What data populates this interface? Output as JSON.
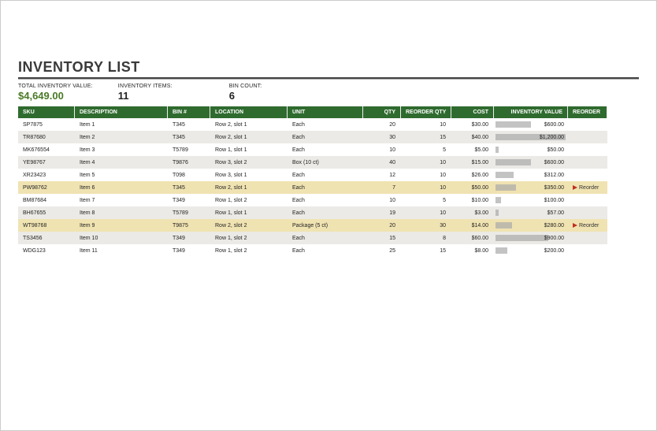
{
  "title": "INVENTORY LIST",
  "summary": {
    "total_label": "TOTAL INVENTORY VALUE:",
    "total_value": "$4,649.00",
    "items_label": "INVENTORY ITEMS:",
    "items_value": "11",
    "bins_label": "BIN COUNT:",
    "bins_value": "6"
  },
  "headers": {
    "sku": "SKU",
    "desc": "DESCRIPTION",
    "bin": "BIN #",
    "location": "LOCATION",
    "unit": "UNIT",
    "qty": "QTY",
    "reorder_qty": "REORDER QTY",
    "cost": "COST",
    "inv_value": "INVENTORY VALUE",
    "reorder": "REORDER"
  },
  "max_value": 1200,
  "rows": [
    {
      "sku": "SP7875",
      "desc": "Item 1",
      "bin": "T345",
      "loc": "Row 2, slot 1",
      "unit": "Each",
      "qty": "20",
      "rqty": "10",
      "cost": "$30.00",
      "val_num": 600,
      "val": "$600.00",
      "warn": false
    },
    {
      "sku": "TR87680",
      "desc": "Item 2",
      "bin": "T345",
      "loc": "Row 2, slot 1",
      "unit": "Each",
      "qty": "30",
      "rqty": "15",
      "cost": "$40.00",
      "val_num": 1200,
      "val": "$1,200.00",
      "warn": false
    },
    {
      "sku": "MK676554",
      "desc": "Item 3",
      "bin": "T5789",
      "loc": "Row 1, slot 1",
      "unit": "Each",
      "qty": "10",
      "rqty": "5",
      "cost": "$5.00",
      "val_num": 50,
      "val": "$50.00",
      "warn": false
    },
    {
      "sku": "YE98767",
      "desc": "Item 4",
      "bin": "T9876",
      "loc": "Row 3, slot 2",
      "unit": "Box (10 ct)",
      "qty": "40",
      "rqty": "10",
      "cost": "$15.00",
      "val_num": 600,
      "val": "$600.00",
      "warn": false
    },
    {
      "sku": "XR23423",
      "desc": "Item 5",
      "bin": "T098",
      "loc": "Row 3, slot 1",
      "unit": "Each",
      "qty": "12",
      "rqty": "10",
      "cost": "$26.00",
      "val_num": 312,
      "val": "$312.00",
      "warn": false
    },
    {
      "sku": "PW98762",
      "desc": "Item 6",
      "bin": "T345",
      "loc": "Row 2, slot 1",
      "unit": "Each",
      "qty": "7",
      "rqty": "10",
      "cost": "$50.00",
      "val_num": 350,
      "val": "$350.00",
      "warn": true,
      "reorder": "Reorder"
    },
    {
      "sku": "BM87684",
      "desc": "Item 7",
      "bin": "T349",
      "loc": "Row 1, slot 2",
      "unit": "Each",
      "qty": "10",
      "rqty": "5",
      "cost": "$10.00",
      "val_num": 100,
      "val": "$100.00",
      "warn": false
    },
    {
      "sku": "BH67655",
      "desc": "Item 8",
      "bin": "T5789",
      "loc": "Row 1, slot 1",
      "unit": "Each",
      "qty": "19",
      "rqty": "10",
      "cost": "$3.00",
      "val_num": 57,
      "val": "$57.00",
      "warn": false
    },
    {
      "sku": "WT98768",
      "desc": "Item 9",
      "bin": "T9875",
      "loc": "Row 2, slot 2",
      "unit": "Package (5 ct)",
      "qty": "20",
      "rqty": "30",
      "cost": "$14.00",
      "val_num": 280,
      "val": "$280.00",
      "warn": true,
      "reorder": "Reorder"
    },
    {
      "sku": "TS3456",
      "desc": "Item 10",
      "bin": "T349",
      "loc": "Row 1, slot 2",
      "unit": "Each",
      "qty": "15",
      "rqty": "8",
      "cost": "$60.00",
      "val_num": 900,
      "val": "$900.00",
      "warn": false
    },
    {
      "sku": "WDG123",
      "desc": "Item 11",
      "bin": "T349",
      "loc": "Row 1, slot 2",
      "unit": "Each",
      "qty": "25",
      "rqty": "15",
      "cost": "$8.00",
      "val_num": 200,
      "val": "$200.00",
      "warn": false
    }
  ],
  "chart_data": {
    "type": "bar",
    "title": "Inventory Value by SKU (in-cell data bars)",
    "xlabel": "SKU",
    "ylabel": "Inventory Value ($)",
    "ylim": [
      0,
      1200
    ],
    "categories": [
      "SP7875",
      "TR87680",
      "MK676554",
      "YE98767",
      "XR23423",
      "PW98762",
      "BM87684",
      "BH67655",
      "WT98768",
      "TS3456",
      "WDG123"
    ],
    "values": [
      600,
      1200,
      50,
      600,
      312,
      350,
      100,
      57,
      280,
      900,
      200
    ]
  }
}
